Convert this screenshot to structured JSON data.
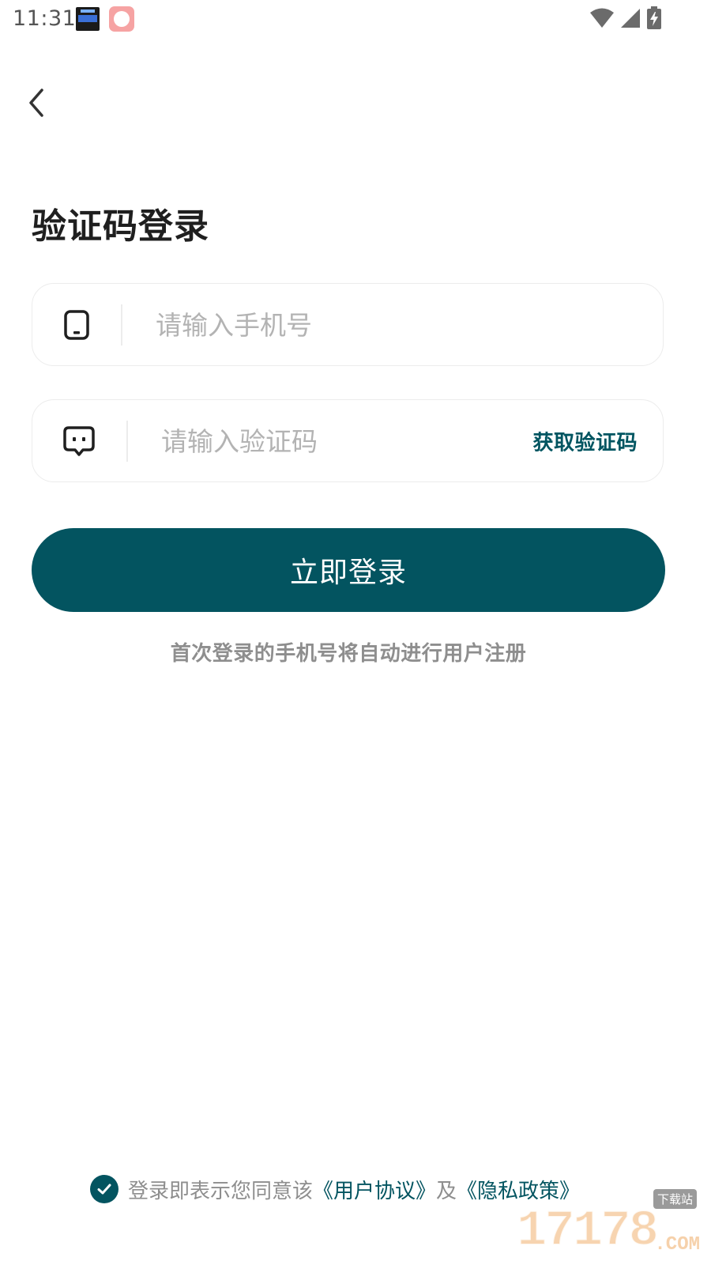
{
  "status_bar": {
    "time": "11:31",
    "icons": [
      "clock-widget-icon",
      "app-icon",
      "wifi-icon",
      "signal-icon",
      "battery-charging-icon"
    ]
  },
  "header": {
    "back_icon": "chevron-left-icon"
  },
  "title": "验证码登录",
  "phone_field": {
    "icon": "phone-icon",
    "placeholder": "请输入手机号",
    "value": ""
  },
  "code_field": {
    "icon": "message-icon",
    "placeholder": "请输入验证码",
    "value": "",
    "get_code_label": "获取验证码"
  },
  "login_button": {
    "label": "立即登录"
  },
  "register_hint": "首次登录的手机号将自动进行用户注册",
  "agreement": {
    "checked": true,
    "prefix": "登录即表示您同意该",
    "user_agreement": "《用户协议》",
    "conjunction": "及",
    "privacy_policy": "《隐私政策》"
  },
  "watermark": {
    "number": "17178",
    "domain": ".COM",
    "tag": "下载站"
  },
  "colors": {
    "accent": "#035460",
    "hint_text": "#8e8e8e",
    "placeholder": "#b3b3b3",
    "border": "#ececec"
  }
}
